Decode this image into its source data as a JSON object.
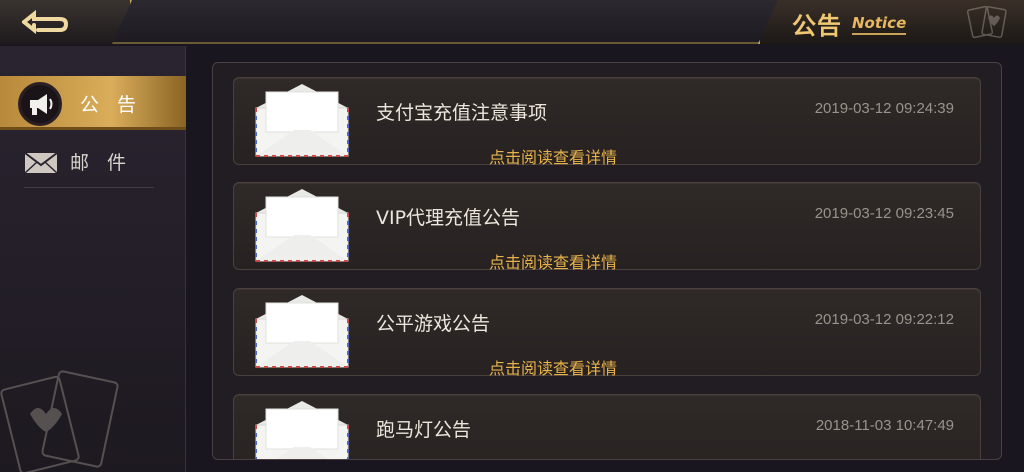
{
  "header": {
    "title_cn": "公告",
    "title_en": "Notice"
  },
  "sidebar": {
    "items": [
      {
        "label": "公 告",
        "icon": "megaphone-icon",
        "active": true
      },
      {
        "label": "邮 件",
        "icon": "mail-icon",
        "active": false
      }
    ]
  },
  "notices": [
    {
      "title": "支付宝充值注意事项",
      "time": "2019-03-12 09:24:39",
      "link": "点击阅读查看详情"
    },
    {
      "title": "VIP代理充值公告",
      "time": "2019-03-12 09:23:45",
      "link": "点击阅读查看详情"
    },
    {
      "title": "公平游戏公告",
      "time": "2019-03-12 09:22:12",
      "link": "点击阅读查看详情"
    },
    {
      "title": "跑马灯公告",
      "time": "2018-11-03 10:47:49",
      "link": ""
    }
  ],
  "colors": {
    "accent_gold": "#d9ad5a",
    "link_gold": "#e8b24a",
    "background": "#1a1620"
  }
}
